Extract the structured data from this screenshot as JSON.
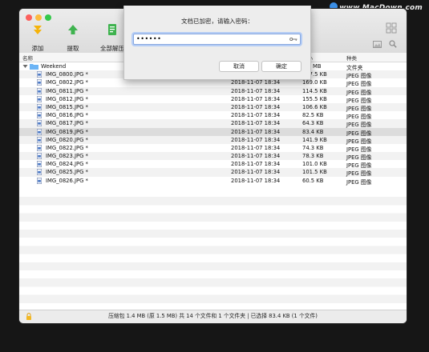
{
  "watermark": "www.MacDown.com",
  "toolbar": {
    "add_label": "添加",
    "extract_label": "提取",
    "extract_all_label": "全部解压"
  },
  "columns": {
    "name": "名称",
    "size": "大小",
    "kind": "种类"
  },
  "folder": {
    "name": "Weekend",
    "size": "1.5 MB",
    "kind": "文件夹"
  },
  "files": [
    {
      "name": "IMG_0800.JPG *",
      "date": "2018-11-07 18:34",
      "size": "107.5 KB",
      "kind": "JPEG 图像"
    },
    {
      "name": "IMG_0802.JPG *",
      "date": "2018-11-07 18:34",
      "size": "169.0 KB",
      "kind": "JPEG 图像"
    },
    {
      "name": "IMG_0811.JPG *",
      "date": "2018-11-07 18:34",
      "size": "114.5 KB",
      "kind": "JPEG 图像"
    },
    {
      "name": "IMG_0812.JPG *",
      "date": "2018-11-07 18:34",
      "size": "155.5 KB",
      "kind": "JPEG 图像"
    },
    {
      "name": "IMG_0815.JPG *",
      "date": "2018-11-07 18:34",
      "size": "106.6 KB",
      "kind": "JPEG 图像"
    },
    {
      "name": "IMG_0816.JPG *",
      "date": "2018-11-07 18:34",
      "size": "82.5 KB",
      "kind": "JPEG 图像"
    },
    {
      "name": "IMG_0817.JPG *",
      "date": "2018-11-07 18:34",
      "size": "64.3 KB",
      "kind": "JPEG 图像"
    },
    {
      "name": "IMG_0819.JPG *",
      "date": "2018-11-07 18:34",
      "size": "83.4 KB",
      "kind": "JPEG 图像",
      "selected": true
    },
    {
      "name": "IMG_0820.JPG *",
      "date": "2018-11-07 18:34",
      "size": "141.9 KB",
      "kind": "JPEG 图像"
    },
    {
      "name": "IMG_0822.JPG *",
      "date": "2018-11-07 18:34",
      "size": "74.3 KB",
      "kind": "JPEG 图像"
    },
    {
      "name": "IMG_0823.JPG *",
      "date": "2018-11-07 18:34",
      "size": "78.3 KB",
      "kind": "JPEG 图像"
    },
    {
      "name": "IMG_0824.JPG *",
      "date": "2018-11-07 18:34",
      "size": "101.0 KB",
      "kind": "JPEG 图像"
    },
    {
      "name": "IMG_0825.JPG *",
      "date": "2018-11-07 18:34",
      "size": "101.5 KB",
      "kind": "JPEG 图像"
    },
    {
      "name": "IMG_0826.JPG *",
      "date": "2018-11-07 18:34",
      "size": "60.5 KB",
      "kind": "JPEG 图像"
    }
  ],
  "status": "压缩包 1.4 MB (原 1.5 MB) 共 14 个文件和 1 个文件夹  |  已选择 83.4 KB (1 个文件)",
  "dialog": {
    "title": "文档已加密，请输入密码：",
    "password_value": "••••••",
    "cancel_label": "取消",
    "ok_label": "确定"
  },
  "colors": {
    "add_icon": "#f5b30a",
    "extract_icon": "#3fb34f",
    "extract_all_icon": "#3fb34f",
    "folder": "#6cb4f5",
    "focus_ring": "#b5cdf5"
  },
  "icons": {
    "add": "arrow-down-icon",
    "extract": "arrow-up-icon",
    "extract_all": "document-icon",
    "folder": "folder-icon",
    "file": "image-file-icon",
    "lock": "lock-icon",
    "key": "key-icon",
    "preview": "image-preview-icon",
    "search": "search-icon",
    "view_toggle": "grid-icon"
  }
}
